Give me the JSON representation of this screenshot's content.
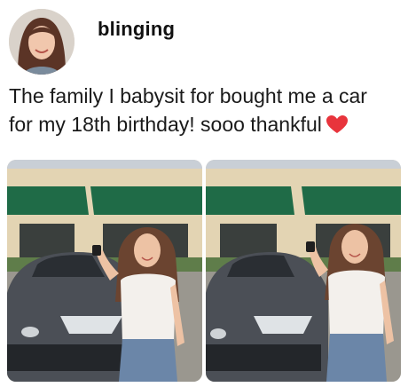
{
  "post": {
    "username": "blinging",
    "caption_line1": "The family I babysit for bought me a car",
    "caption_line2": "for my 18th birthday! sooo thankful",
    "heart_icon": "red-heart-emoji",
    "photo_count": 2
  },
  "colors": {
    "awning": "#1f6b47",
    "building": "#e3d4b3",
    "car": "#4b4f56",
    "heart": "#e8343c"
  }
}
